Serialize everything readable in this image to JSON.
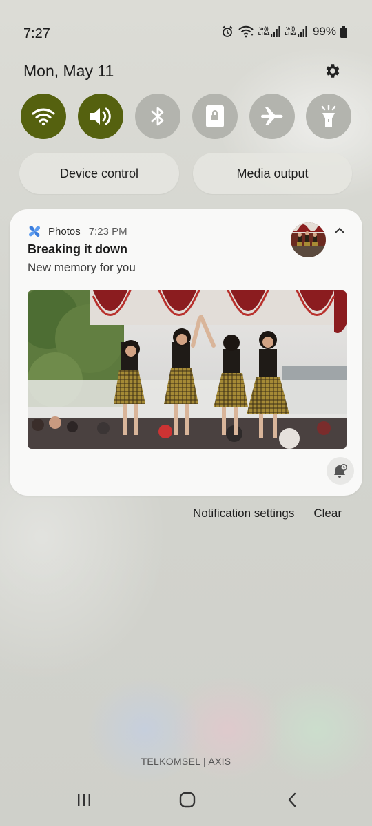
{
  "status_bar": {
    "time": "7:27",
    "sim1": "LTE1",
    "sim2": "LTE2",
    "volte": "Vo))",
    "battery": "99%"
  },
  "header": {
    "date": "Mon, May 11",
    "settings_icon": "gear-icon"
  },
  "quick_settings": [
    {
      "name": "wifi",
      "icon": "wifi-icon",
      "state": "on"
    },
    {
      "name": "sound",
      "icon": "volume-icon",
      "state": "on"
    },
    {
      "name": "bluetooth",
      "icon": "bluetooth-icon",
      "state": "off"
    },
    {
      "name": "screen-lock",
      "icon": "lock-rotation-icon",
      "state": "off"
    },
    {
      "name": "airplane",
      "icon": "airplane-icon",
      "state": "off"
    },
    {
      "name": "flashlight",
      "icon": "flashlight-icon",
      "state": "off"
    }
  ],
  "buttons": {
    "device_control": "Device control",
    "media_output": "Media output"
  },
  "notification": {
    "app": "Photos",
    "time": "7:23 PM",
    "title": "Breaking it down",
    "text": "New memory for you"
  },
  "notification_actions": {
    "settings": "Notification settings",
    "clear": "Clear"
  },
  "carrier": "TELKOMSEL | AXIS",
  "colors": {
    "toggle_on": "#55610f",
    "toggle_off": "#b3b4ae",
    "card_bg": "#f9f9f8"
  }
}
